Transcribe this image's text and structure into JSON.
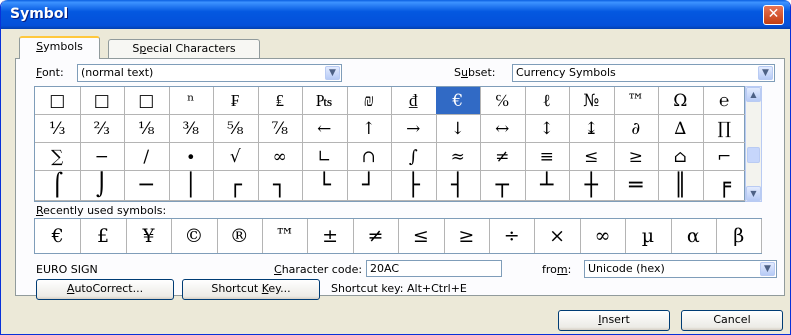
{
  "window": {
    "title": "Symbol",
    "close_glyph": "✕"
  },
  "tabs": [
    {
      "label": "Symbols",
      "mnemonic": "S",
      "rest": "ymbols",
      "active": true
    },
    {
      "label": "Special Characters",
      "before": "S",
      "mnemonic": "p",
      "rest": "ecial Characters",
      "active": false
    }
  ],
  "font": {
    "mnemonic": "F",
    "label_rest": "ont:",
    "value": "(normal text)"
  },
  "subset": {
    "before": "S",
    "mnemonic": "u",
    "label_rest": "bset:",
    "value": "Currency Symbols"
  },
  "symbol_grid": {
    "rows": [
      [
        "□",
        "□",
        "□",
        "ⁿ",
        "₣",
        "₤",
        "₧",
        "₪",
        "₫",
        "€",
        "℅",
        "ℓ",
        "№",
        "™",
        "Ω",
        "℮"
      ],
      [
        "⅓",
        "⅔",
        "⅛",
        "⅜",
        "⅝",
        "⅞",
        "←",
        "↑",
        "→",
        "↓",
        "↔",
        "↕",
        "↨",
        "∂",
        "∆",
        "∏"
      ],
      [
        "∑",
        "−",
        "∕",
        "∙",
        "√",
        "∞",
        "∟",
        "∩",
        "∫",
        "≈",
        "≠",
        "≡",
        "≤",
        "≥",
        "⌂",
        "⌐"
      ],
      [
        "⌠",
        "⌡",
        "─",
        "│",
        "┌",
        "┐",
        "└",
        "┘",
        "├",
        "┤",
        "┬",
        "┴",
        "┼",
        "═",
        "║",
        "╒"
      ]
    ],
    "selected": {
      "row": 0,
      "col": 9
    }
  },
  "recent": {
    "label_mnemonic": "R",
    "label_rest": "ecently used symbols:",
    "symbols": [
      "€",
      "£",
      "¥",
      "©",
      "®",
      "™",
      "±",
      "≠",
      "≤",
      "≥",
      "÷",
      "×",
      "∞",
      "µ",
      "α",
      "β"
    ]
  },
  "character_name": "EURO SIGN",
  "character_code": {
    "mnemonic": "C",
    "label_rest": "haracter code:",
    "value": "20AC"
  },
  "from": {
    "before": "fro",
    "mnemonic": "m",
    "label_rest": ":",
    "value": "Unicode (hex)"
  },
  "buttons": {
    "autocorrect": {
      "mnemonic": "A",
      "rest": "utoCorrect..."
    },
    "shortcut_key": {
      "before": "Shortcut ",
      "mnemonic": "K",
      "rest": "ey..."
    },
    "insert": {
      "mnemonic": "I",
      "rest": "nsert"
    },
    "cancel": "Cancel"
  },
  "shortcut_text": "Shortcut key: Alt+Ctrl+E",
  "icons": {
    "dropdown": "chevron-down-icon",
    "scroll_up": "scroll-up-icon",
    "scroll_down": "scroll-down-icon",
    "close": "close-icon"
  }
}
